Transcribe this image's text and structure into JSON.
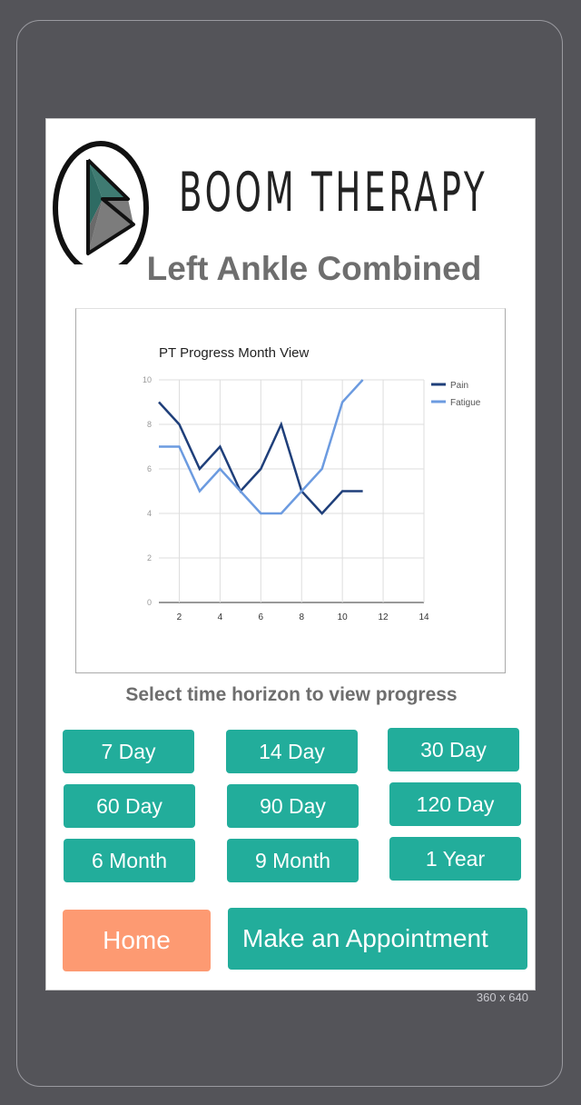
{
  "app": {
    "brand_name": "BOOM THERAPY",
    "page_title": "Left Ankle Combined",
    "screen_size_label": "360 x 640"
  },
  "chart_data": {
    "type": "line",
    "title": "PT Progress Month View",
    "xlabel": "",
    "ylabel": "",
    "xlim": [
      1,
      14
    ],
    "ylim": [
      0,
      10
    ],
    "xticks": [
      2,
      4,
      6,
      8,
      10,
      12,
      14
    ],
    "yticks": [
      0,
      2,
      4,
      6,
      8,
      10
    ],
    "grid": true,
    "legend_position": "right",
    "series": [
      {
        "name": "Pain",
        "color": "#1f3f7a",
        "x": [
          1,
          2,
          3,
          4,
          5,
          6,
          7,
          8,
          9,
          10,
          11
        ],
        "values": [
          9,
          8,
          6,
          7,
          5,
          6,
          8,
          5,
          4,
          5,
          5
        ]
      },
      {
        "name": "Fatigue",
        "color": "#6c9be0",
        "x": [
          1,
          2,
          3,
          4,
          5,
          6,
          7,
          8,
          9,
          10,
          11
        ],
        "values": [
          7,
          7,
          5,
          6,
          5,
          4,
          4,
          5,
          6,
          9,
          10
        ]
      }
    ]
  },
  "prompt": "Select time horizon to view progress",
  "horizons": [
    "7 Day",
    "14 Day",
    "30 Day",
    "60 Day",
    "90 Day",
    "120 Day",
    "6 Month",
    "9 Month",
    "1 Year"
  ],
  "actions": {
    "home_label": "Home",
    "appointment_label": "Make an Appointment"
  },
  "colors": {
    "primary": "#22ad9b",
    "home": "#fd9a72",
    "frame": "#545459"
  }
}
